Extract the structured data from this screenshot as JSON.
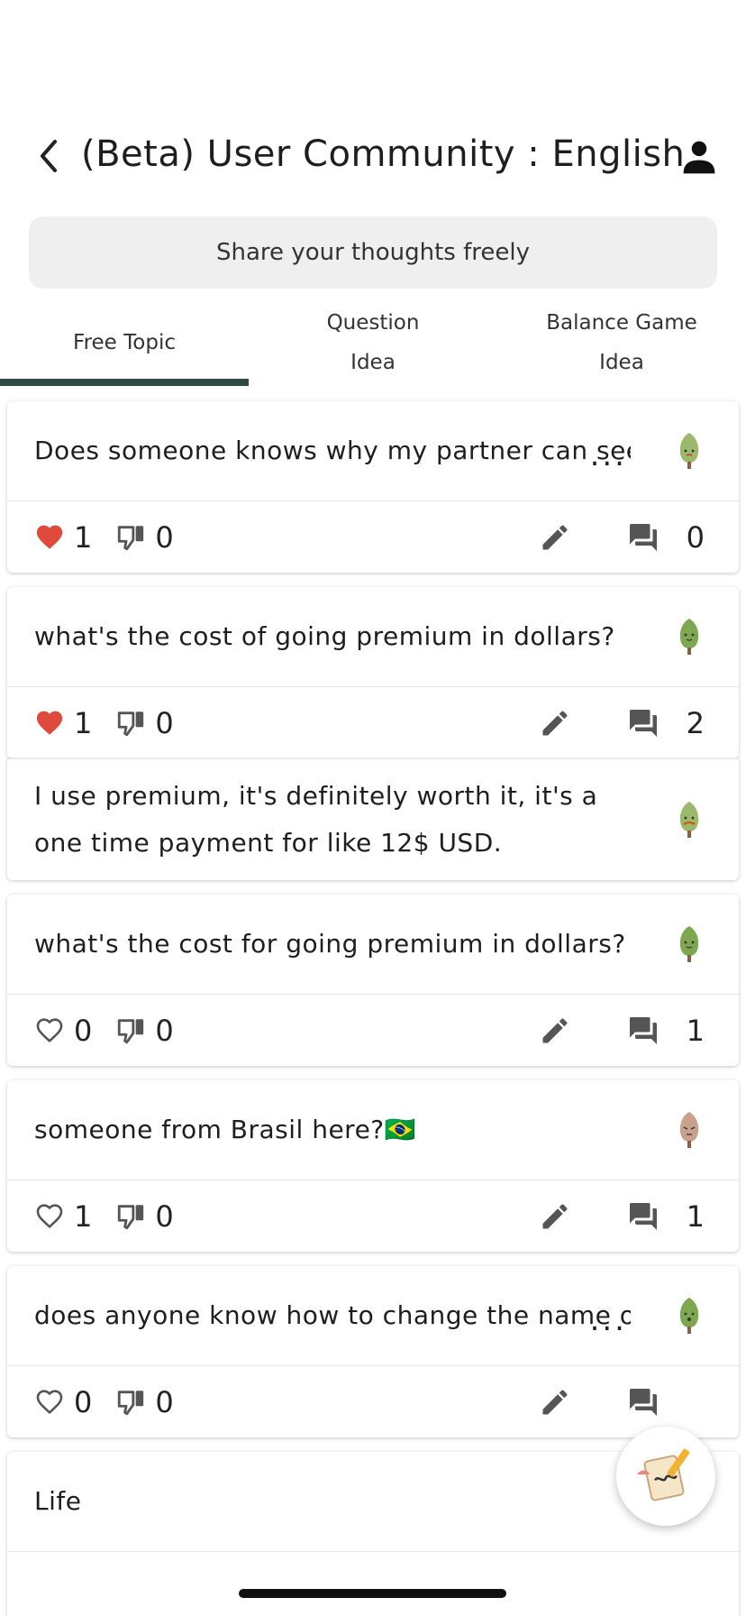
{
  "header": {
    "title": "(Beta) User Community : English",
    "back_icon": "chevron-left-icon",
    "profile_icon": "person-icon"
  },
  "share_prompt": "Share your thoughts freely",
  "tabs": [
    {
      "label": "Free Topic",
      "active": true
    },
    {
      "label": "Question\nIdea",
      "active": false
    },
    {
      "label": "Balance Game\nIdea",
      "active": false
    }
  ],
  "posts": [
    {
      "text": "Does someone knows why my partner can see",
      "ellipsis": "...",
      "likes": "1",
      "liked": true,
      "dislikes": "0",
      "comments": "0",
      "avatar_color": "#9cb86a"
    },
    {
      "text": "what's the cost of going premium in dollars?",
      "likes": "1",
      "liked": true,
      "dislikes": "0",
      "comments": "2",
      "avatar_color": "#7ea850"
    },
    {
      "text": "I use premium, it's definitely worth it, it's a one time payment for like 12$ USD.",
      "reply": true,
      "avatar_color": "#9cb86a"
    },
    {
      "text": "what's the cost for going premium in dollars?",
      "likes": "0",
      "liked": false,
      "dislikes": "0",
      "comments": "1",
      "avatar_color": "#7ea850"
    },
    {
      "text": "someone from Brasil here?🇧🇷",
      "likes": "1",
      "liked": false,
      "dislikes": "0",
      "comments": "1",
      "avatar_color": "#c9a08c"
    },
    {
      "text": "does anyone know how to change the name of",
      "ellipsis": "...",
      "likes": "0",
      "liked": false,
      "dislikes": "0",
      "comments": "",
      "avatar_color": "#7ea850"
    },
    {
      "text": "Life",
      "avatar_color": "#7ea850"
    }
  ],
  "colors": {
    "accent": "#2e4a44",
    "like_red": "#e04a3c",
    "icon_gray": "#555555"
  }
}
